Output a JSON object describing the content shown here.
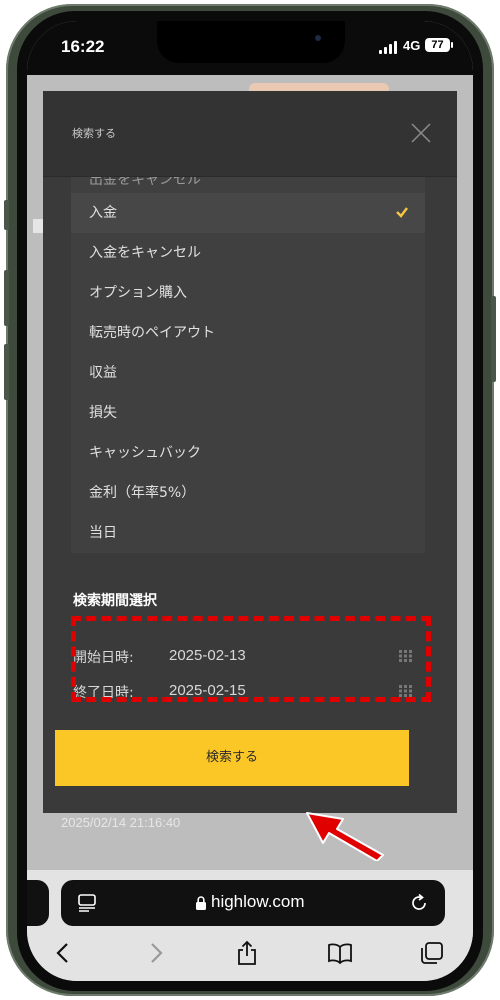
{
  "status_bar": {
    "time": "16:22",
    "network": "4G",
    "battery": "77"
  },
  "modal": {
    "title": "検索する",
    "list_top_fragment": "出金をキャンセル",
    "items": [
      {
        "label": "入金",
        "selected": true
      },
      {
        "label": "入金をキャンセル",
        "selected": false
      },
      {
        "label": "オプション購入",
        "selected": false
      },
      {
        "label": "転売時のペイアウト",
        "selected": false
      },
      {
        "label": "収益",
        "selected": false
      },
      {
        "label": "損失",
        "selected": false
      },
      {
        "label": "キャッシュバック",
        "selected": false
      },
      {
        "label": "金利（年率5%）",
        "selected": false
      },
      {
        "label": "当日",
        "selected": false
      }
    ],
    "period_section_title": "検索期間選択",
    "start_label": "開始日時:",
    "start_value": "2025-02-13",
    "end_label": "終了日時:",
    "end_value": "2025-02-15",
    "search_button_label": "検索する"
  },
  "background_timestamp": "2025/02/14 21:16:40",
  "browser": {
    "url": "highlow.com"
  },
  "colors": {
    "accent_yellow": "#fbc727",
    "annotation_red": "#e00000",
    "check_yellow": "#f5c542"
  },
  "icons": [
    "close-icon",
    "check-icon",
    "grip-icon",
    "lock-icon",
    "tabs-icon",
    "reload-icon",
    "back-icon",
    "forward-icon",
    "share-icon",
    "bookmarks-icon",
    "tabs-overview-icon"
  ]
}
